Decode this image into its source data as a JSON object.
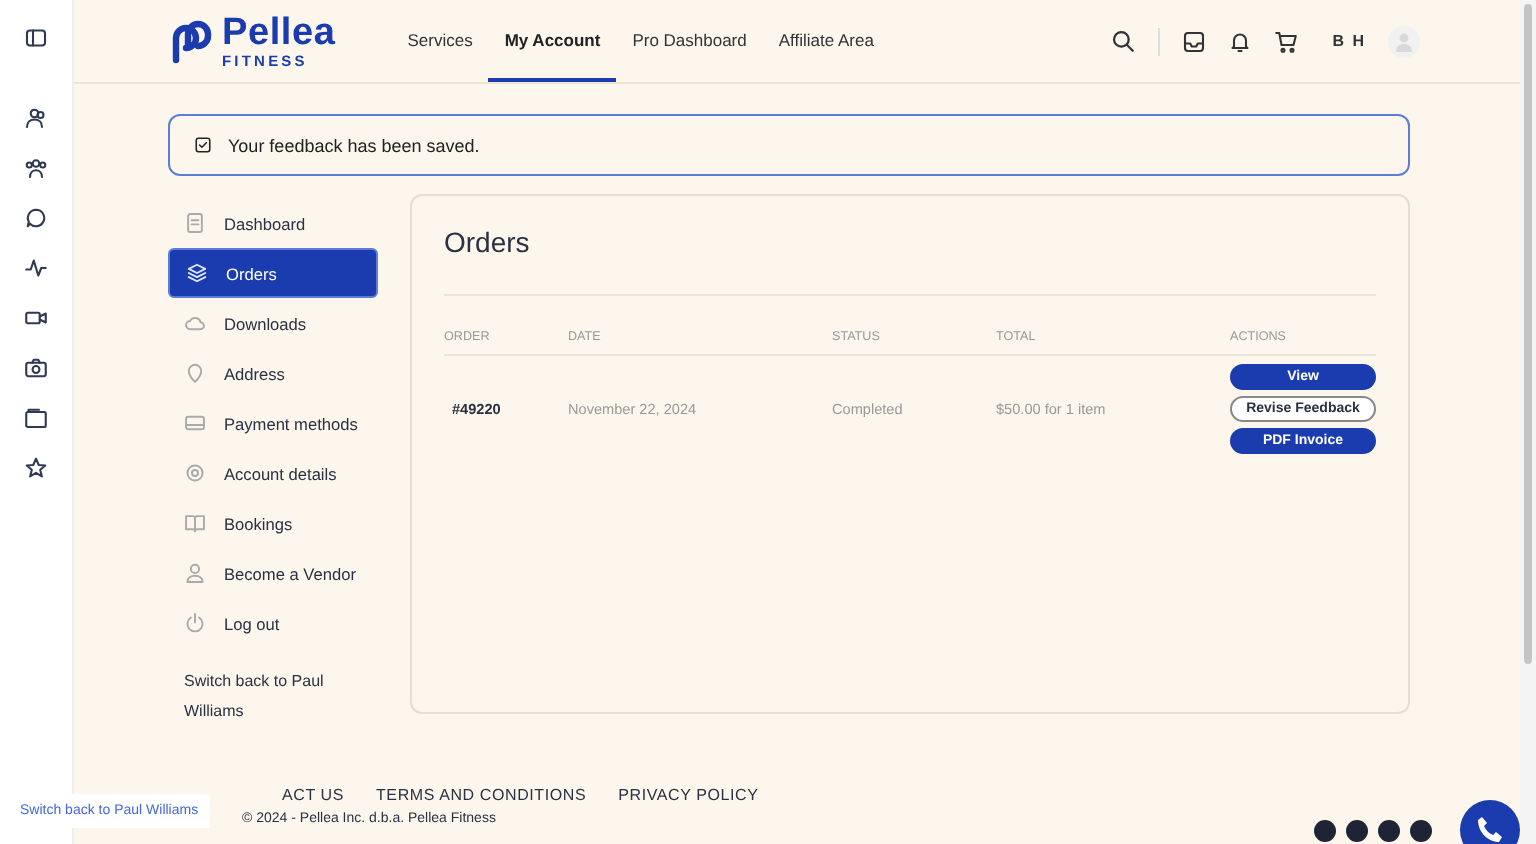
{
  "header": {
    "logo": {
      "name": "Pellea",
      "tagline": "FITNESS"
    },
    "nav": [
      {
        "label": "Services",
        "selected": false
      },
      {
        "label": "My Account",
        "selected": true
      },
      {
        "label": "Pro Dashboard",
        "selected": false
      },
      {
        "label": "Affiliate Area",
        "selected": false
      }
    ],
    "user_initials": "B H"
  },
  "notice": {
    "message": "Your feedback has been saved."
  },
  "account_nav": {
    "items": [
      {
        "label": "Dashboard",
        "selected": false
      },
      {
        "label": "Orders",
        "selected": true
      },
      {
        "label": "Downloads",
        "selected": false
      },
      {
        "label": "Address",
        "selected": false
      },
      {
        "label": "Payment methods",
        "selected": false
      },
      {
        "label": "Account details",
        "selected": false
      },
      {
        "label": "Bookings",
        "selected": false
      },
      {
        "label": "Become a Vendor",
        "selected": false
      },
      {
        "label": "Log out",
        "selected": false
      }
    ],
    "switch_link": "Switch back to Paul Williams"
  },
  "orders": {
    "title": "Orders",
    "columns": [
      "ORDER",
      "DATE",
      "STATUS",
      "TOTAL",
      "ACTIONS"
    ],
    "rows": [
      {
        "order": "#49220",
        "date": "November 22, 2024",
        "status": "Completed",
        "total": "$50.00 for 1 item",
        "actions": [
          {
            "label": "View",
            "kind": "primary"
          },
          {
            "label": "Revise Feedback",
            "kind": "outline"
          },
          {
            "label": "PDF Invoice",
            "kind": "primary"
          }
        ]
      }
    ]
  },
  "footer": {
    "links": [
      "ACT US",
      "TERMS AND CONDITIONS",
      "PRIVACY POLICY"
    ],
    "copyright": "© 2024 - Pellea Inc. d.b.a. Pellea Fitness"
  },
  "switch_banner": "Switch back to Paul Williams"
}
